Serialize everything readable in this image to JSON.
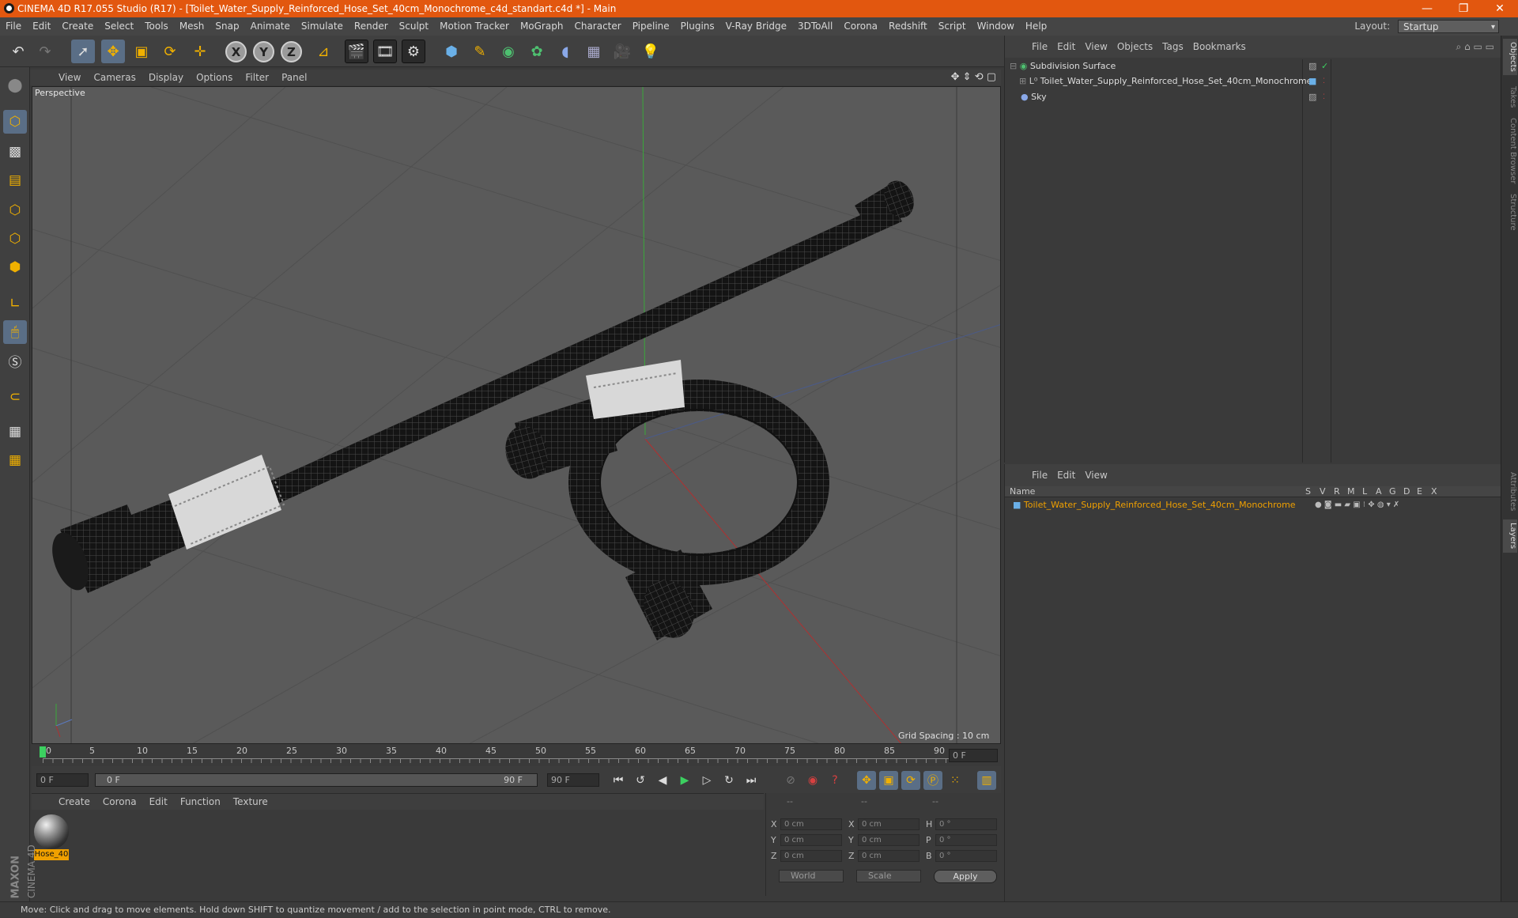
{
  "window": {
    "title": "CINEMA 4D R17.055 Studio (R17) - [Toilet_Water_Supply_Reinforced_Hose_Set_40cm_Monochrome_c4d_standart.c4d *] - Main",
    "minimize": "—",
    "restore": "❐",
    "close": "✕"
  },
  "menubar": [
    "File",
    "Edit",
    "Create",
    "Select",
    "Tools",
    "Mesh",
    "Snap",
    "Animate",
    "Simulate",
    "Render",
    "Sculpt",
    "Motion Tracker",
    "MoGraph",
    "Character",
    "Pipeline",
    "Plugins",
    "V-Ray Bridge",
    "3DToAll",
    "Corona",
    "Redshift",
    "Script",
    "Window",
    "Help"
  ],
  "layout": {
    "label": "Layout:",
    "value": "Startup"
  },
  "toolbar": {
    "x": "X",
    "y": "Y",
    "z": "Z"
  },
  "viewport": {
    "menu": [
      "View",
      "Cameras",
      "Display",
      "Options",
      "Filter",
      "Panel"
    ],
    "label": "Perspective",
    "grid_spacing": "Grid Spacing : 10 cm"
  },
  "timeline": {
    "ticks": [
      "0",
      "5",
      "10",
      "15",
      "20",
      "25",
      "30",
      "35",
      "40",
      "45",
      "50",
      "55",
      "60",
      "65",
      "70",
      "75",
      "80",
      "85",
      "90"
    ],
    "current_frame": "0 F"
  },
  "transport": {
    "start": "0 F",
    "range_start": "0 F",
    "range_end": "90 F",
    "end": "90 F"
  },
  "material_panel": {
    "menu": [
      "Create",
      "Corona",
      "Edit",
      "Function",
      "Texture"
    ],
    "material_name": "Hose_40"
  },
  "coords": {
    "header": [
      "--",
      "--",
      "--"
    ],
    "rows": [
      {
        "a": "X",
        "v1": "0 cm",
        "b": "X",
        "v2": "0 cm",
        "c": "H",
        "v3": "0 °"
      },
      {
        "a": "Y",
        "v1": "0 cm",
        "b": "Y",
        "v2": "0 cm",
        "c": "P",
        "v3": "0 °"
      },
      {
        "a": "Z",
        "v1": "0 cm",
        "b": "Z",
        "v2": "0 cm",
        "c": "B",
        "v3": "0 °"
      }
    ],
    "space": "World",
    "mode": "Scale",
    "apply": "Apply"
  },
  "brand": {
    "maxon": "MAXON",
    "product": "CINEMA 4D"
  },
  "status": "Move: Click and drag to move elements. Hold down SHIFT to quantize movement / add to the selection in point mode, CTRL to remove.",
  "objects_panel": {
    "menu": [
      "File",
      "Edit",
      "View",
      "Objects",
      "Tags",
      "Bookmarks"
    ],
    "items": [
      {
        "name": "Subdivision Surface"
      },
      {
        "name": "Toilet_Water_Supply_Reinforced_Hose_Set_40cm_Monochrome"
      },
      {
        "name": "Sky"
      }
    ]
  },
  "layers_panel": {
    "menu": [
      "File",
      "Edit",
      "View"
    ],
    "columns": [
      "Name",
      "S",
      "V",
      "R",
      "M",
      "L",
      "A",
      "G",
      "D",
      "E",
      "X"
    ],
    "items": [
      {
        "name": "Toilet_Water_Supply_Reinforced_Hose_Set_40cm_Monochrome"
      }
    ]
  },
  "right_tabs": [
    "Objects",
    "Takes",
    "Content Browser",
    "Structure",
    "Attributes",
    "Layers"
  ],
  "colors": {
    "accent": "#e2570f",
    "selected_layer": "#f0a000",
    "axis_y": "#3aa83a",
    "axis_x": "#c03030"
  }
}
